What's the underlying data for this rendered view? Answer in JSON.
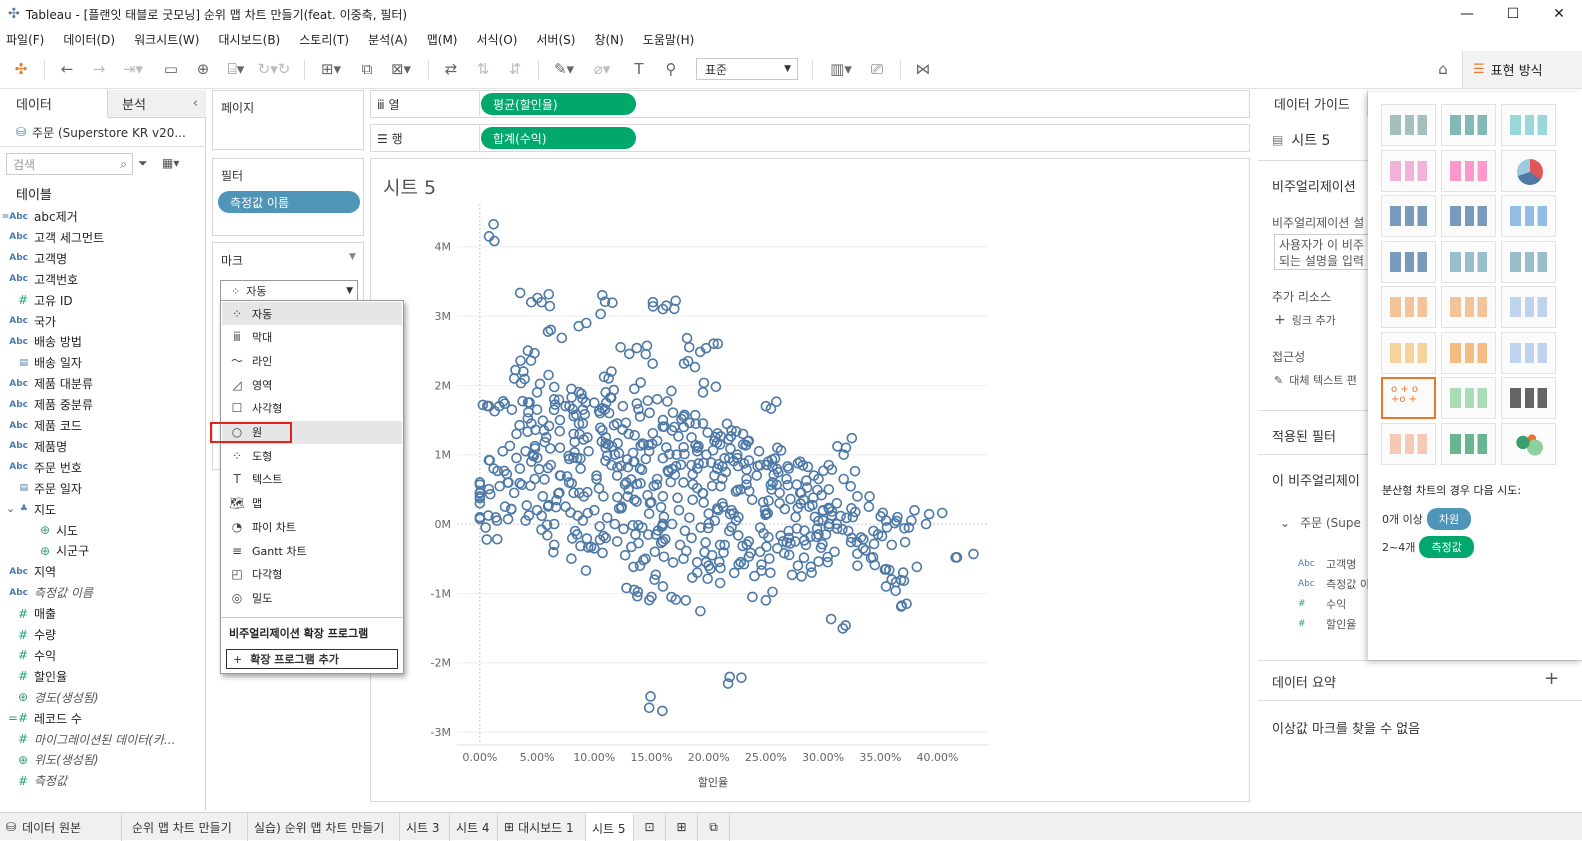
{
  "window": {
    "title": "Tableau - [플랜잇 태블로 굿모닝] 순위 맵 차트 만들기(feat. 이중축, 필터)"
  },
  "menu": [
    "파일(F)",
    "데이터(D)",
    "워크시트(W)",
    "대시보드(B)",
    "스토리(T)",
    "분석(A)",
    "맵(M)",
    "서식(O)",
    "서버(S)",
    "창(N)",
    "도움말(H)"
  ],
  "toolbar": {
    "fit_select": "표준",
    "show_me_label": "표현 방식"
  },
  "left": {
    "tab_data": "데이터",
    "tab_analysis": "분석",
    "datasource": "주문 (Superstore KR v20...",
    "search_placeholder": "검색",
    "tables_header": "테이블",
    "fields": [
      {
        "icon": "=Abc",
        "name": "abc제거"
      },
      {
        "icon": "Abc",
        "name": "고객 세그먼트"
      },
      {
        "icon": "Abc",
        "name": "고객명"
      },
      {
        "icon": "Abc",
        "name": "고객번호"
      },
      {
        "icon": "#",
        "name": "고유 ID"
      },
      {
        "icon": "Abc",
        "name": "국가"
      },
      {
        "icon": "Abc",
        "name": "배송 방법"
      },
      {
        "icon": "cal",
        "name": "배송 일자"
      },
      {
        "icon": "Abc",
        "name": "제품 대분류"
      },
      {
        "icon": "Abc",
        "name": "제품 중분류"
      },
      {
        "icon": "Abc",
        "name": "제품 코드"
      },
      {
        "icon": "Abc",
        "name": "제품명"
      },
      {
        "icon": "Abc",
        "name": "주문 번호"
      },
      {
        "icon": "cal",
        "name": "주문 일자"
      },
      {
        "icon": "hier",
        "name": "지도"
      },
      {
        "icon": "globe",
        "name": "시도"
      },
      {
        "icon": "globe",
        "name": "시군구"
      },
      {
        "icon": "Abc",
        "name": "지역"
      },
      {
        "icon": "Abc",
        "name": "측정값 이름"
      },
      {
        "icon": "#",
        "name": "매출"
      },
      {
        "icon": "#",
        "name": "수량"
      },
      {
        "icon": "#",
        "name": "수익"
      },
      {
        "icon": "#",
        "name": "할인율"
      },
      {
        "icon": "globe",
        "name": "경도(생성됨)"
      },
      {
        "icon": "=#",
        "name": "레코드 수"
      },
      {
        "icon": "#",
        "name": "마이그레이션된 데이터(카..."
      },
      {
        "icon": "globe",
        "name": "위도(생성됨)"
      },
      {
        "icon": "#",
        "name": "측정값"
      }
    ]
  },
  "shelves": {
    "pages_label": "페이지",
    "columns_label": "열",
    "rows_label": "행",
    "columns_pill": "평균(할인율)",
    "rows_pill": "합계(수익)",
    "filters_label": "필터",
    "filter_pill": "측정값 이름",
    "marks_label": "마크",
    "mark_type": "자동"
  },
  "mark_menu": {
    "items": [
      "자동",
      "막대",
      "라인",
      "영역",
      "사각형",
      "원",
      "도형",
      "텍스트",
      "맵",
      "파이 차트",
      "Gantt 차트",
      "다각형",
      "밀도"
    ],
    "selected": "원",
    "ext_header": "비주얼리제이션 확장 프로그램",
    "ext_button": "확장 프로그램 추가"
  },
  "sheet": {
    "title": "시트 5"
  },
  "chart_data": {
    "type": "scatter",
    "title": "시트 5",
    "xlabel": "할인율",
    "ylabel": "",
    "xlim": [
      -0.02,
      0.445
    ],
    "ylim": [
      -3100000,
      4400000
    ],
    "xticks": [
      "0.00%",
      "5.00%",
      "10.00%",
      "15.00%",
      "20.00%",
      "25.00%",
      "30.00%",
      "35.00%",
      "40.00%"
    ],
    "yticks": [
      "4M",
      "3M",
      "2M",
      "1M",
      "0M",
      "-1M",
      "-2M",
      "-3M"
    ],
    "marker": "circle-open",
    "color": "#4e79a7",
    "points": [
      [
        0.008,
        4150000
      ],
      [
        0.045,
        3200000
      ],
      [
        0.054,
        3200000
      ],
      [
        0.107,
        3300000
      ],
      [
        0.16,
        3100000
      ],
      [
        0.163,
        3150000
      ],
      [
        0.093,
        2900000
      ],
      [
        0.062,
        2800000
      ],
      [
        0.208,
        2600000
      ],
      [
        0.123,
        2550000
      ],
      [
        0.183,
        2550000
      ],
      [
        0.145,
        2450000
      ],
      [
        0.042,
        2500000
      ],
      [
        0.182,
        2350000
      ],
      [
        0.038,
        2200000
      ],
      [
        0.06,
        2150000
      ],
      [
        0.115,
        2200000
      ],
      [
        0.03,
        2100000
      ],
      [
        0.017,
        1700000
      ],
      [
        0.008,
        1700000
      ],
      [
        0.09,
        1650000
      ],
      [
        0.125,
        1700000
      ],
      [
        0.25,
        1700000
      ],
      [
        0.05,
        1650000
      ],
      [
        0.075,
        1700000
      ],
      [
        0.105,
        1600000
      ],
      [
        0.14,
        1550000
      ],
      [
        0.09,
        1450000
      ],
      [
        0.12,
        1450000
      ],
      [
        0.17,
        1400000
      ],
      [
        0.032,
        1300000
      ],
      [
        0.056,
        1350000
      ],
      [
        0.082,
        1300000
      ],
      [
        0.11,
        1250000
      ],
      [
        0.13,
        1300000
      ],
      [
        0.155,
        1200000
      ],
      [
        0.185,
        1250000
      ],
      [
        0.21,
        1150000
      ],
      [
        0.235,
        1200000
      ],
      [
        0.26,
        1100000
      ],
      [
        0.02,
        1050000
      ],
      [
        0.04,
        1050000
      ],
      [
        0.07,
        1100000
      ],
      [
        0.095,
        1050000
      ],
      [
        0.118,
        1000000
      ],
      [
        0.148,
        1050000
      ],
      [
        0.172,
        1000000
      ],
      [
        0.198,
        1000000
      ],
      [
        0.225,
        950000
      ],
      [
        0.252,
        900000
      ],
      [
        0.28,
        900000
      ],
      [
        0.305,
        850000
      ],
      [
        0.012,
        800000
      ],
      [
        0.035,
        800000
      ],
      [
        0.062,
        850000
      ],
      [
        0.088,
        800000
      ],
      [
        0.115,
        850000
      ],
      [
        0.14,
        800000
      ],
      [
        0.165,
        750000
      ],
      [
        0.19,
        800000
      ],
      [
        0.215,
        750000
      ],
      [
        0.242,
        700000
      ],
      [
        0.268,
        650000
      ],
      [
        0.292,
        700000
      ],
      [
        0.318,
        650000
      ],
      [
        0.0,
        600000
      ],
      [
        0.025,
        600000
      ],
      [
        0.048,
        650000
      ],
      [
        0.078,
        600000
      ],
      [
        0.102,
        650000
      ],
      [
        0.128,
        600000
      ],
      [
        0.152,
        550000
      ],
      [
        0.178,
        600000
      ],
      [
        0.203,
        550000
      ],
      [
        0.228,
        500000
      ],
      [
        0.255,
        500000
      ],
      [
        0.28,
        450000
      ],
      [
        0.305,
        500000
      ],
      [
        0.33,
        400000
      ],
      [
        0.0,
        400000
      ],
      [
        0.03,
        450000
      ],
      [
        0.055,
        400000
      ],
      [
        0.082,
        450000
      ],
      [
        0.108,
        400000
      ],
      [
        0.135,
        350000
      ],
      [
        0.16,
        400000
      ],
      [
        0.186,
        350000
      ],
      [
        0.212,
        300000
      ],
      [
        0.238,
        350000
      ],
      [
        0.262,
        300000
      ],
      [
        0.288,
        250000
      ],
      [
        0.312,
        300000
      ],
      [
        0.34,
        250000
      ],
      [
        0.0,
        300000
      ],
      [
        0.022,
        250000
      ],
      [
        0.05,
        200000
      ],
      [
        0.075,
        250000
      ],
      [
        0.1,
        200000
      ],
      [
        0.124,
        250000
      ],
      [
        0.148,
        150000
      ],
      [
        0.174,
        200000
      ],
      [
        0.2,
        150000
      ],
      [
        0.226,
        100000
      ],
      [
        0.25,
        150000
      ],
      [
        0.276,
        100000
      ],
      [
        0.3,
        50000
      ],
      [
        0.326,
        100000
      ],
      [
        0.355,
        50000
      ],
      [
        0.0,
        100000
      ],
      [
        0.015,
        50000
      ],
      [
        0.04,
        50000
      ],
      [
        0.065,
        0
      ],
      [
        0.09,
        50000
      ],
      [
        0.118,
        0
      ],
      [
        0.142,
        -50000
      ],
      [
        0.168,
        0
      ],
      [
        0.193,
        -50000
      ],
      [
        0.218,
        -100000
      ],
      [
        0.245,
        -50000
      ],
      [
        0.27,
        -100000
      ],
      [
        0.296,
        -150000
      ],
      [
        0.322,
        -100000
      ],
      [
        0.348,
        -150000
      ],
      [
        0.375,
        -50000
      ],
      [
        0.005,
        -50000
      ],
      [
        0.085,
        -150000
      ],
      [
        0.11,
        -200000
      ],
      [
        0.136,
        -150000
      ],
      [
        0.16,
        -250000
      ],
      [
        0.185,
        -200000
      ],
      [
        0.21,
        -300000
      ],
      [
        0.235,
        -250000
      ],
      [
        0.26,
        -350000
      ],
      [
        0.285,
        -300000
      ],
      [
        0.31,
        -400000
      ],
      [
        0.335,
        -350000
      ],
      [
        0.36,
        -300000
      ],
      [
        0.1,
        -350000
      ],
      [
        0.127,
        -450000
      ],
      [
        0.153,
        -400000
      ],
      [
        0.178,
        -500000
      ],
      [
        0.203,
        -450000
      ],
      [
        0.228,
        -550000
      ],
      [
        0.253,
        -500000
      ],
      [
        0.278,
        -600000
      ],
      [
        0.304,
        -550000
      ],
      [
        0.33,
        -600000
      ],
      [
        0.355,
        -650000
      ],
      [
        0.08,
        -500000
      ],
      [
        0.14,
        -600000
      ],
      [
        0.19,
        -700000
      ],
      [
        0.24,
        -750000
      ],
      [
        0.29,
        -700000
      ],
      [
        0.36,
        -800000
      ],
      [
        0.37,
        -700000
      ],
      [
        0.417,
        -480000
      ],
      [
        0.21,
        -850000
      ],
      [
        0.16,
        -900000
      ],
      [
        0.135,
        -950000
      ],
      [
        0.15,
        -1050000
      ],
      [
        0.18,
        -1100000
      ],
      [
        0.25,
        -1100000
      ],
      [
        0.355,
        -900000
      ],
      [
        0.373,
        -1150000
      ],
      [
        0.307,
        -1370000
      ],
      [
        0.217,
        -2300000
      ],
      [
        0.148,
        -2650000
      ],
      [
        0.05,
        1900000
      ],
      [
        0.08,
        1950000
      ],
      [
        0.11,
        1900000
      ],
      [
        0.065,
        1800000
      ],
      [
        0.1,
        1750000
      ],
      [
        0.155,
        1800000
      ],
      [
        0.195,
        1900000
      ],
      [
        0.135,
        1950000
      ],
      [
        0.07,
        1500000
      ],
      [
        0.16,
        1500000
      ],
      [
        0.195,
        1450000
      ],
      [
        0.045,
        1450000
      ],
      [
        0.22,
        1350000
      ],
      [
        0.11,
        1100000
      ],
      [
        0.085,
        950000
      ],
      [
        0.135,
        900000
      ],
      [
        0.16,
        950000
      ],
      [
        0.19,
        1100000
      ],
      [
        0.23,
        1300000
      ],
      [
        0.155,
        650000
      ],
      [
        0.205,
        700000
      ],
      [
        0.245,
        850000
      ],
      [
        0.27,
        800000
      ],
      [
        0.12,
        700000
      ],
      [
        0.07,
        700000
      ],
      [
        0.045,
        900000
      ],
      [
        0.225,
        1000000
      ],
      [
        0.185,
        850000
      ],
      [
        0.13,
        500000
      ],
      [
        0.22,
        200000
      ],
      [
        0.265,
        -250000
      ],
      [
        0.175,
        -300000
      ],
      [
        0.245,
        -400000
      ],
      [
        0.12,
        -250000
      ],
      [
        0.065,
        -300000
      ],
      [
        0.2,
        -600000
      ],
      [
        0.27,
        -200000
      ],
      [
        0.296,
        650000
      ],
      [
        0.32,
        1100000
      ],
      [
        0.028,
        1650000
      ],
      [
        0.113,
        1600000
      ],
      [
        0.178,
        1550000
      ],
      [
        0.058,
        1250000
      ],
      [
        0.094,
        1250000
      ],
      [
        0.143,
        1150000
      ],
      [
        0.168,
        1350000
      ],
      [
        0.19,
        1050000
      ],
      [
        0.205,
        1200000
      ],
      [
        0.218,
        950000
      ],
      [
        0.244,
        1050000
      ],
      [
        0.256,
        600000
      ],
      [
        0.262,
        450000
      ],
      [
        0.283,
        350000
      ],
      [
        0.3,
        200000
      ],
      [
        0.312,
        0
      ],
      [
        0.325,
        -200000
      ],
      [
        0.344,
        -100000
      ],
      [
        0.365,
        100000
      ],
      [
        0.39,
        0
      ]
    ]
  },
  "right": {
    "data_guide_tab": "데이터 가이드",
    "sheet_name": "시트 5",
    "viz_section": "비주얼리제이션",
    "viz_desc_label": "비주얼리제이션 설",
    "desc_placeholder_1": "사용자가 이 비주",
    "desc_placeholder_2": "되는 설명을 입력",
    "resources_label": "추가 리소스",
    "add_link": "링크 추가",
    "accessibility_label": "접근성",
    "alt_text": "대체 텍스트 편",
    "applied_filters": "적용된 필터",
    "this_viz": "이 비주얼리제이",
    "source_node": "주문 (Supe",
    "used_fields": [
      {
        "icon": "Abc",
        "name": "고객명"
      },
      {
        "icon": "Abc",
        "name": "측정값 이"
      },
      {
        "icon": "#",
        "name": "수익"
      },
      {
        "icon": "#",
        "name": "할인율"
      }
    ],
    "data_summary": "데이터 요약",
    "no_outliers": "이상값 마크를 찾을 수 없음"
  },
  "showme": {
    "hint": "분산형 차트의 경우 다음 시도:",
    "req1_prefix": "0개 이상",
    "req1_badge": "차원",
    "req2_prefix": "2~4개",
    "req2_badge": "측정값"
  },
  "bottom_tabs": [
    "데이터 원본",
    "순위 맵 차트 만들기",
    "실습) 순위 맵 차트 만들기",
    "시트 3",
    "시트 4",
    "대시보드 1",
    "시트 5"
  ]
}
